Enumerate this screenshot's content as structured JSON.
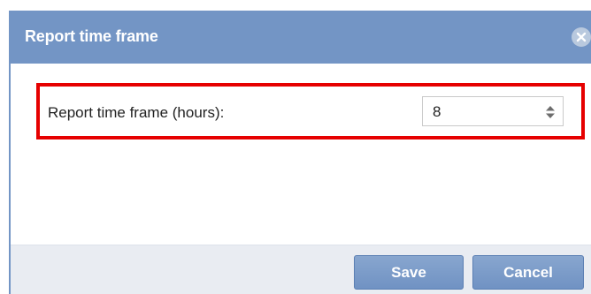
{
  "dialog": {
    "title": "Report time frame",
    "close_icon": "close-circle-icon"
  },
  "field": {
    "label": "Report time frame (hours):",
    "value": "8",
    "spinner_icon": "up-down-arrows-icon"
  },
  "buttons": {
    "save_label": "Save",
    "cancel_label": "Cancel"
  },
  "colors": {
    "titlebar": "#7395c5",
    "highlight_border": "#e60000",
    "button": "#7b9bc9",
    "footer": "#e9ecf2"
  }
}
